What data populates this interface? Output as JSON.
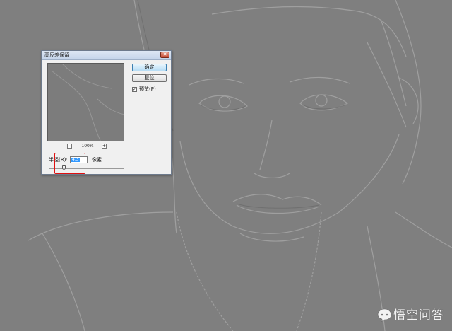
{
  "dialog": {
    "title": "高反差保留",
    "close_glyph": "✕",
    "ok_label": "确定",
    "reset_label": "复位",
    "preview_checkbox": {
      "label": "预览(P)",
      "checked": true,
      "mark": "✓"
    },
    "zoom": {
      "level": "100%",
      "zoom_out": "−",
      "zoom_in": "+"
    },
    "radius": {
      "label": "半径(R):",
      "value": "4.3",
      "unit": "像素",
      "slider_fraction": 0.2
    }
  },
  "colors": {
    "canvas": "#7f7f7f",
    "highlight": "#e01010",
    "selection": "#3399ff"
  },
  "watermark": {
    "text": "悟空问答"
  }
}
